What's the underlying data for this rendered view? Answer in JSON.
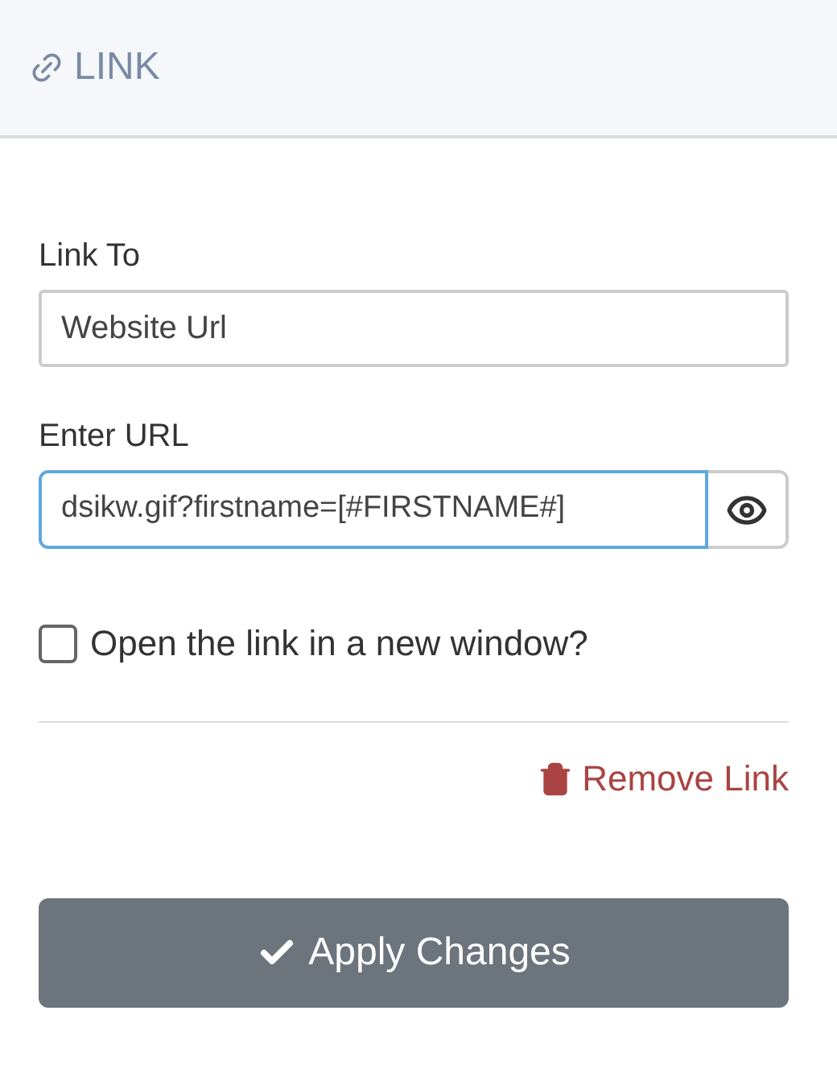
{
  "header": {
    "title": "LINK"
  },
  "link_to": {
    "label": "Link To",
    "value": "Website Url"
  },
  "url": {
    "label": "Enter URL",
    "value": "dsikw.gif?firstname=[#FIRSTNAME#]",
    "focused": true
  },
  "new_window": {
    "label": "Open the link in a new window?",
    "checked": false
  },
  "remove_link": {
    "label": "Remove Link"
  },
  "apply_button": {
    "label": "Apply Changes"
  }
}
